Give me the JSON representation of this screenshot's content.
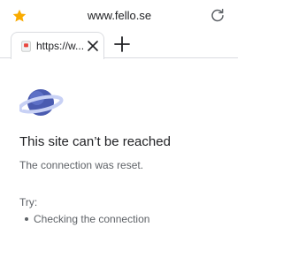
{
  "toolbar": {
    "url_display": "www.fello.se",
    "star_icon": "star-icon",
    "reload_icon": "reload-icon",
    "star_color": "#F9AB00"
  },
  "tabs": [
    {
      "title": "https://w...",
      "favicon": "document-icon",
      "close_icon": "close-icon"
    }
  ],
  "new_tab_icon": "plus-icon",
  "error": {
    "icon": "planet-icon",
    "title": "This site can’t be reached",
    "detail": "The connection was reset.",
    "try_label": "Try:",
    "suggestions": [
      "Checking the connection"
    ]
  }
}
